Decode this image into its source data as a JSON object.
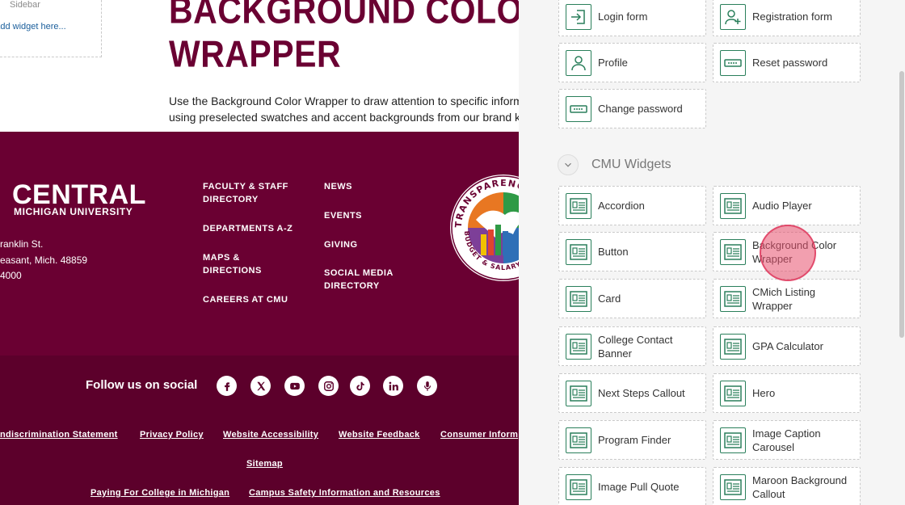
{
  "sidebar": {
    "label": "Sidebar",
    "add_widget": "Add widget here..."
  },
  "hero": {
    "title_line1": "BACKGROUND COLOR",
    "title_line2": "WRAPPER",
    "description": "Use the Background Color Wrapper to draw attention to specific information or content using preselected swatches and accent backgrounds from our brand kit."
  },
  "footer": {
    "logo_main": "CENTRAL",
    "logo_sub": "MICHIGAN UNIVERSITY",
    "address": [
      "ranklin St.",
      "easant, Mich. 48859",
      "4000"
    ],
    "col1": [
      "FACULTY & STAFF DIRECTORY",
      "DEPARTMENTS A-Z",
      "MAPS & DIRECTIONS",
      "CAREERS AT CMU"
    ],
    "col2": [
      "NEWS",
      "EVENTS",
      "GIVING",
      "SOCIAL MEDIA DIRECTORY"
    ],
    "seal_top": "TRANSPARENCY",
    "seal_bottom": "BUDGET & SALARY/C",
    "follow": "Follow us on social",
    "social_icons": [
      "facebook-icon",
      "x-icon",
      "youtube-icon",
      "instagram-icon",
      "tiktok-icon",
      "linkedin-icon",
      "podcast-icon"
    ],
    "bottom_links": [
      "ndiscrimination Statement",
      "Privacy Policy",
      "Website Accessibility",
      "Website Feedback",
      "Consumer Inform"
    ],
    "sitemap": "Sitemap",
    "bottom_links2": [
      "Paying For College in Michigan",
      "Campus Safety Information and Resources"
    ]
  },
  "panel": {
    "top_widgets": [
      {
        "label": "Login form",
        "icon": "login-icon"
      },
      {
        "label": "Registration form",
        "icon": "add-user-icon"
      },
      {
        "label": "Profile",
        "icon": "user-icon"
      },
      {
        "label": "Reset password",
        "icon": "password-icon"
      },
      {
        "label": "Change password",
        "icon": "password-icon"
      }
    ],
    "section_title": "CMU Widgets",
    "cmu_widgets": [
      {
        "label": "Accordion"
      },
      {
        "label": "Audio Player"
      },
      {
        "label": "Button"
      },
      {
        "label": "Background Color Wrapper"
      },
      {
        "label": "Card"
      },
      {
        "label": "CMich Listing Wrapper"
      },
      {
        "label": "College Contact Banner"
      },
      {
        "label": "GPA Calculator"
      },
      {
        "label": "Next Steps Callout"
      },
      {
        "label": "Hero"
      },
      {
        "label": "Program Finder"
      },
      {
        "label": "Image Caption Carousel"
      },
      {
        "label": "Image Pull Quote"
      },
      {
        "label": "Maroon Background Callout"
      }
    ]
  },
  "colors": {
    "maroon": "#6a0032",
    "maroon_dark": "#5c002b",
    "gold": "#f0c100",
    "widget_green": "#2a7f5b"
  }
}
